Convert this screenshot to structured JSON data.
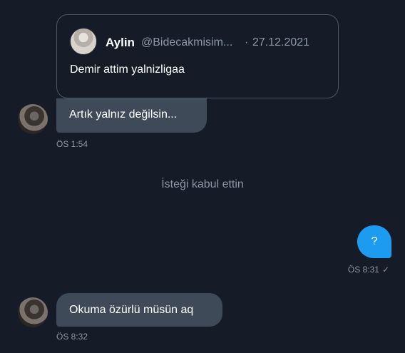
{
  "quoted_tweet": {
    "name": "Aylin",
    "handle": "@Bidecakmisim...",
    "separator": "·",
    "date": "27.12.2021",
    "text": "Demir attim yalnizligaa"
  },
  "messages": [
    {
      "direction": "in",
      "text": "Artık yalnız değilsin...",
      "time": "ÖS 1:54"
    },
    {
      "direction": "out",
      "text": "?",
      "time": "ÖS 8:31",
      "status_icon": "check-icon"
    },
    {
      "direction": "in",
      "text": "Okuma özürlü müsün aq",
      "time": "ÖS 8:32"
    }
  ],
  "system_message": "İsteği kabul ettin",
  "colors": {
    "background": "#151c27",
    "incoming_bubble": "#3e4a58",
    "outgoing_bubble": "#1d9bf0",
    "muted_text": "#8b98a5"
  }
}
